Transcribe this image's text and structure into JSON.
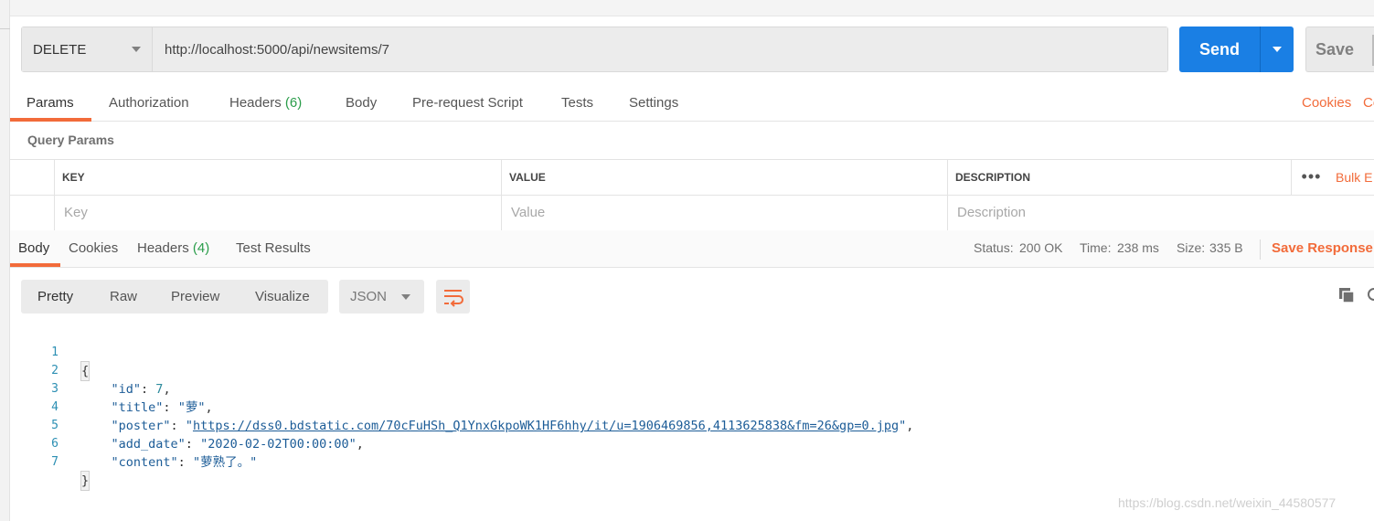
{
  "request": {
    "method": "DELETE",
    "url": "http://localhost:5000/api/newsitems/7",
    "send_label": "Send",
    "save_label": "Save"
  },
  "request_tabs": {
    "params": "Params",
    "authorization": "Authorization",
    "headers": "Headers",
    "headers_count": "(6)",
    "body": "Body",
    "prerequest": "Pre-request Script",
    "tests": "Tests",
    "settings": "Settings",
    "cookies": "Cookies",
    "code": "Co"
  },
  "query_params": {
    "title": "Query Params",
    "columns": {
      "key": "KEY",
      "value": "VALUE",
      "description": "DESCRIPTION"
    },
    "placeholders": {
      "key": "Key",
      "value": "Value",
      "description": "Description"
    },
    "more": "•••",
    "bulk_edit": "Bulk E"
  },
  "response_tabs": {
    "body": "Body",
    "cookies": "Cookies",
    "headers": "Headers",
    "headers_count": "(4)",
    "test_results": "Test Results"
  },
  "response_meta": {
    "status_label": "Status:",
    "status_value": "200 OK",
    "time_label": "Time:",
    "time_value": "238 ms",
    "size_label": "Size:",
    "size_value": "335 B",
    "save_response": "Save Response"
  },
  "viewer": {
    "modes": [
      "Pretty",
      "Raw",
      "Preview",
      "Visualize"
    ],
    "active_mode": "Pretty",
    "format": "JSON"
  },
  "code": {
    "line_numbers": [
      "1",
      "2",
      "3",
      "4",
      "5",
      "6",
      "7"
    ],
    "open_brace": "{",
    "close_brace": "}",
    "id_key": "\"id\"",
    "id_value": "7",
    "title_key": "\"title\"",
    "title_value": "萝",
    "poster_key": "\"poster\"",
    "poster_value": "https://dss0.bdstatic.com/70cFuHSh_Q1YnxGkpoWK1HF6hhy/it/u=1906469856,4113625838&fm=26&gp=0.jpg",
    "add_date_key": "\"add_date\"",
    "add_date_value": "2020-02-02T00:00:00",
    "content_key": "\"content\"",
    "content_value": "萝熟了。"
  },
  "watermark": "https://blog.csdn.net/weixin_44580577",
  "colors": {
    "accent": "#f26b3a",
    "send": "#1a7fe4",
    "status_green": "#2a9d4a",
    "json_string": "#1c5c97"
  }
}
